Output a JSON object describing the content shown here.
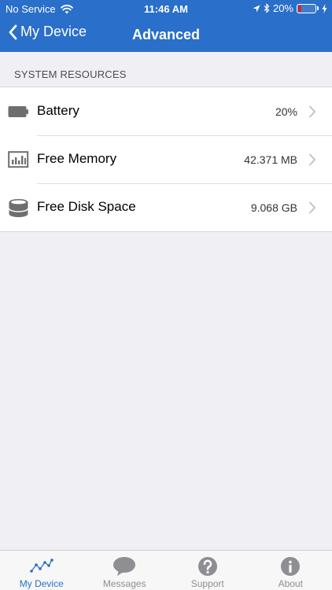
{
  "status_bar": {
    "carrier": "No Service",
    "time": "11:46 AM",
    "battery_percent": "20%",
    "battery_level": 0.2,
    "icons": [
      "wifi-icon",
      "location-arrow-icon",
      "bluetooth-icon",
      "battery-icon",
      "charging-bolt-icon"
    ]
  },
  "nav": {
    "back_label": "My Device",
    "title": "Advanced"
  },
  "section": {
    "label": "SYSTEM RESOURCES"
  },
  "rows": [
    {
      "label": "Battery",
      "value": "20%",
      "icon": "battery-icon"
    },
    {
      "label": "Free Memory",
      "value": "42.371 MB",
      "icon": "memory-chart-icon"
    },
    {
      "label": "Free Disk Space",
      "value": "9.068 GB",
      "icon": "disk-icon"
    }
  ],
  "tabs": [
    {
      "label": "My Device",
      "icon": "activity-line-icon",
      "active": true
    },
    {
      "label": "Messages",
      "icon": "speech-bubble-icon",
      "active": false
    },
    {
      "label": "Support",
      "icon": "question-circle-icon",
      "active": false
    },
    {
      "label": "About",
      "icon": "info-circle-icon",
      "active": false
    }
  ],
  "colors": {
    "accent": "#2a6fc9",
    "background": "#efeff4",
    "icon_gray": "#6e6e6e",
    "tab_inactive": "#8e8e93",
    "battery_low": "#e02020"
  }
}
